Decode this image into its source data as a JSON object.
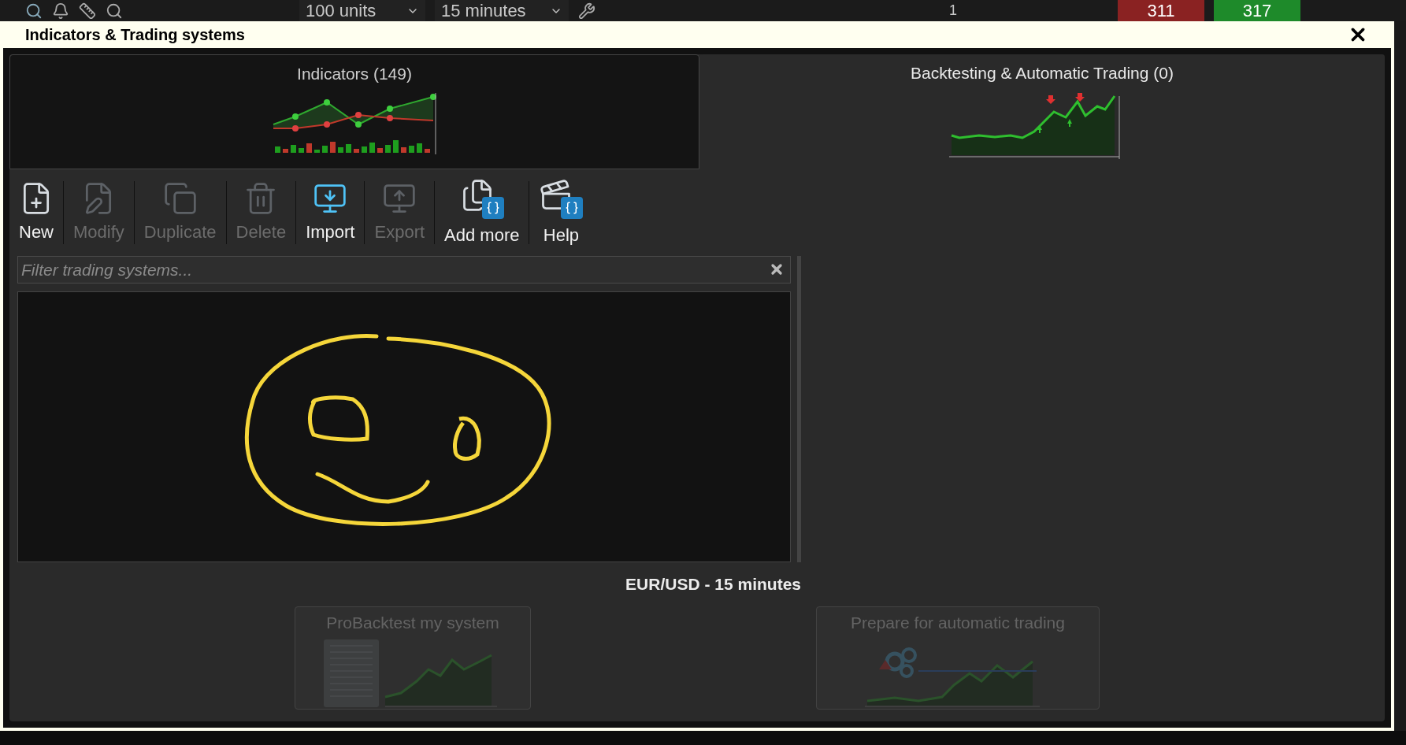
{
  "app_toolbar": {
    "quantity": "100 units",
    "timeframe": "15 minutes",
    "count": "1",
    "bid": "311",
    "ask": "317"
  },
  "dialog": {
    "title": "Indicators & Trading systems"
  },
  "tabs": [
    {
      "label": "Indicators (149)",
      "selected": false,
      "kind": "indicators"
    },
    {
      "label": "Backtesting & Automatic Trading (0)",
      "selected": true,
      "kind": "backtest"
    }
  ],
  "toolbar": [
    {
      "label": "New",
      "disabled": false,
      "kind": "new"
    },
    {
      "label": "Modify",
      "disabled": true,
      "kind": "modify"
    },
    {
      "label": "Duplicate",
      "disabled": true,
      "kind": "duplicate"
    },
    {
      "label": "Delete",
      "disabled": true,
      "kind": "delete"
    },
    {
      "label": "Import",
      "disabled": false,
      "kind": "import"
    },
    {
      "label": "Export",
      "disabled": true,
      "kind": "export"
    },
    {
      "label": "Add more",
      "disabled": false,
      "kind": "addmore"
    },
    {
      "label": "Help",
      "disabled": false,
      "kind": "help"
    }
  ],
  "filter": {
    "placeholder": "Filter trading systems..."
  },
  "instrument": "EUR/USD - 15 minutes",
  "actions": [
    {
      "label": "ProBacktest my system",
      "disabled": true,
      "kind": "backtest"
    },
    {
      "label": "Prepare for automatic trading",
      "disabled": true,
      "kind": "automatic"
    }
  ]
}
